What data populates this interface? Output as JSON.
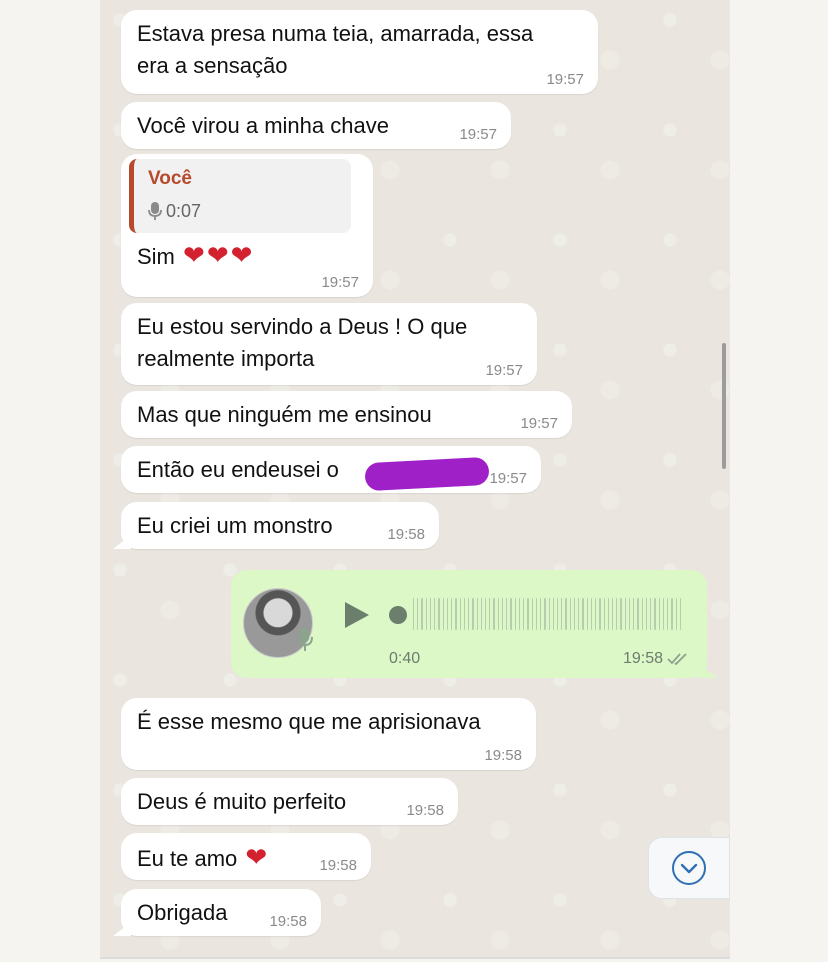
{
  "messages": [
    {
      "lines": [
        "Estava presa numa teia, amarrada, essa",
        "era a sensação"
      ],
      "time": "19:57"
    },
    {
      "lines": [
        "Você virou a minha chave"
      ],
      "time": "19:57"
    },
    {
      "quote": {
        "author": "Você",
        "duration": "0:07"
      },
      "lines": [
        "Sim"
      ],
      "time": "19:57"
    },
    {
      "lines": [
        "Eu estou servindo a Deus ! O que",
        "realmente importa"
      ],
      "time": "19:57"
    },
    {
      "lines": [
        "Mas que ninguém me ensinou"
      ],
      "time": "19:57"
    },
    {
      "lines": [
        "Então eu endeusei o"
      ],
      "time": "19:57"
    },
    {
      "lines": [
        "Eu criei um monstro"
      ],
      "time": "19:58"
    },
    {
      "lines": [
        "É esse mesmo que me aprisionava"
      ],
      "time": "19:58"
    },
    {
      "lines": [
        "Deus é muito perfeito"
      ],
      "time": "19:58"
    },
    {
      "lines": [
        "Eu te amo"
      ],
      "time": "19:58"
    },
    {
      "lines": [
        "Obrigada"
      ],
      "time": "19:58"
    }
  ],
  "voice_note": {
    "duration": "0:40",
    "time": "19:58",
    "status": "delivered"
  },
  "icons": {
    "mic": "mic-icon",
    "play": "play-icon",
    "scroll_down": "chevron-down-icon",
    "check": "double-check-icon"
  },
  "colors": {
    "incoming": "#ffffff",
    "outgoing": "#dcf8c6",
    "quote_accent": "#b54a2c",
    "redaction": "#a020c8"
  }
}
